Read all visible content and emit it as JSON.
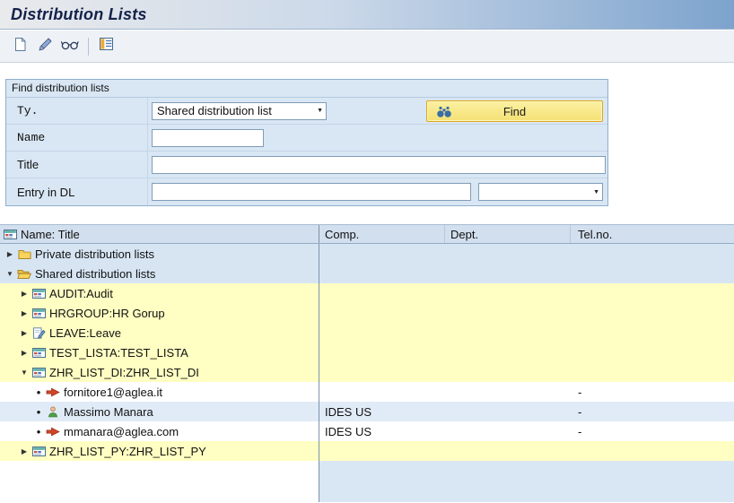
{
  "window": {
    "title": "Distribution Lists"
  },
  "toolbar": {
    "buttons": [
      {
        "name": "new-document"
      },
      {
        "name": "edit-pencil"
      },
      {
        "name": "display-glasses"
      },
      {
        "name": "list-view"
      }
    ]
  },
  "find_panel": {
    "title": "Find distribution lists",
    "rows": [
      {
        "label": "Ty.",
        "value": "Shared distribution list"
      },
      {
        "label": "Name",
        "value": ""
      },
      {
        "label": "Title",
        "value": ""
      },
      {
        "label": "Entry in DL",
        "value": "",
        "value2": ""
      }
    ],
    "find_button": {
      "label": "Find"
    }
  },
  "table": {
    "columns": [
      {
        "label": "Name: Title"
      },
      {
        "label": "Comp."
      },
      {
        "label": "Dept."
      },
      {
        "label": "Tel.no."
      }
    ],
    "rows": [
      {
        "bg": "blue",
        "level": 0,
        "arrow": "collapsed",
        "icon": "folder",
        "name": "Private distribution lists",
        "comp": "",
        "dept": "",
        "tel": ""
      },
      {
        "bg": "blue",
        "level": 0,
        "arrow": "expanded",
        "icon": "folder-open",
        "name": "Shared distribution lists",
        "comp": "",
        "dept": "",
        "tel": ""
      },
      {
        "bg": "yellow",
        "level": 1,
        "arrow": "collapsed",
        "icon": "dist-list",
        "name": "AUDIT:Audit",
        "comp": "",
        "dept": "",
        "tel": ""
      },
      {
        "bg": "yellow",
        "level": 1,
        "arrow": "collapsed",
        "icon": "dist-list",
        "name": "HRGROUP:HR Gorup",
        "comp": "",
        "dept": "",
        "tel": ""
      },
      {
        "bg": "yellow",
        "level": 1,
        "arrow": "collapsed",
        "icon": "doc-edit",
        "name": "LEAVE:Leave",
        "comp": "",
        "dept": "",
        "tel": ""
      },
      {
        "bg": "yellow",
        "level": 1,
        "arrow": "collapsed",
        "icon": "dist-list",
        "name": "TEST_LISTA:TEST_LISTA",
        "comp": "",
        "dept": "",
        "tel": ""
      },
      {
        "bg": "yellow",
        "level": 1,
        "arrow": "expanded",
        "icon": "dist-list",
        "name": "ZHR_LIST_DI:ZHR_LIST_DI",
        "comp": "",
        "dept": "",
        "tel": ""
      },
      {
        "bg": "white",
        "level": 2,
        "arrow": "bullet",
        "icon": "email",
        "name": "fornitore1@aglea.it",
        "comp": "",
        "dept": "",
        "tel": "-"
      },
      {
        "bg": "altblue",
        "level": 2,
        "arrow": "bullet",
        "icon": "person",
        "name": "Massimo Manara",
        "comp": "IDES US",
        "dept": "",
        "tel": "-"
      },
      {
        "bg": "white",
        "level": 2,
        "arrow": "bullet",
        "icon": "email",
        "name": "mmanara@aglea.com",
        "comp": "IDES US",
        "dept": "",
        "tel": "-"
      },
      {
        "bg": "yellow",
        "level": 1,
        "arrow": "collapsed",
        "icon": "dist-list",
        "name": "ZHR_LIST_PY:ZHR_LIST_PY",
        "comp": "",
        "dept": "",
        "tel": ""
      }
    ]
  }
}
